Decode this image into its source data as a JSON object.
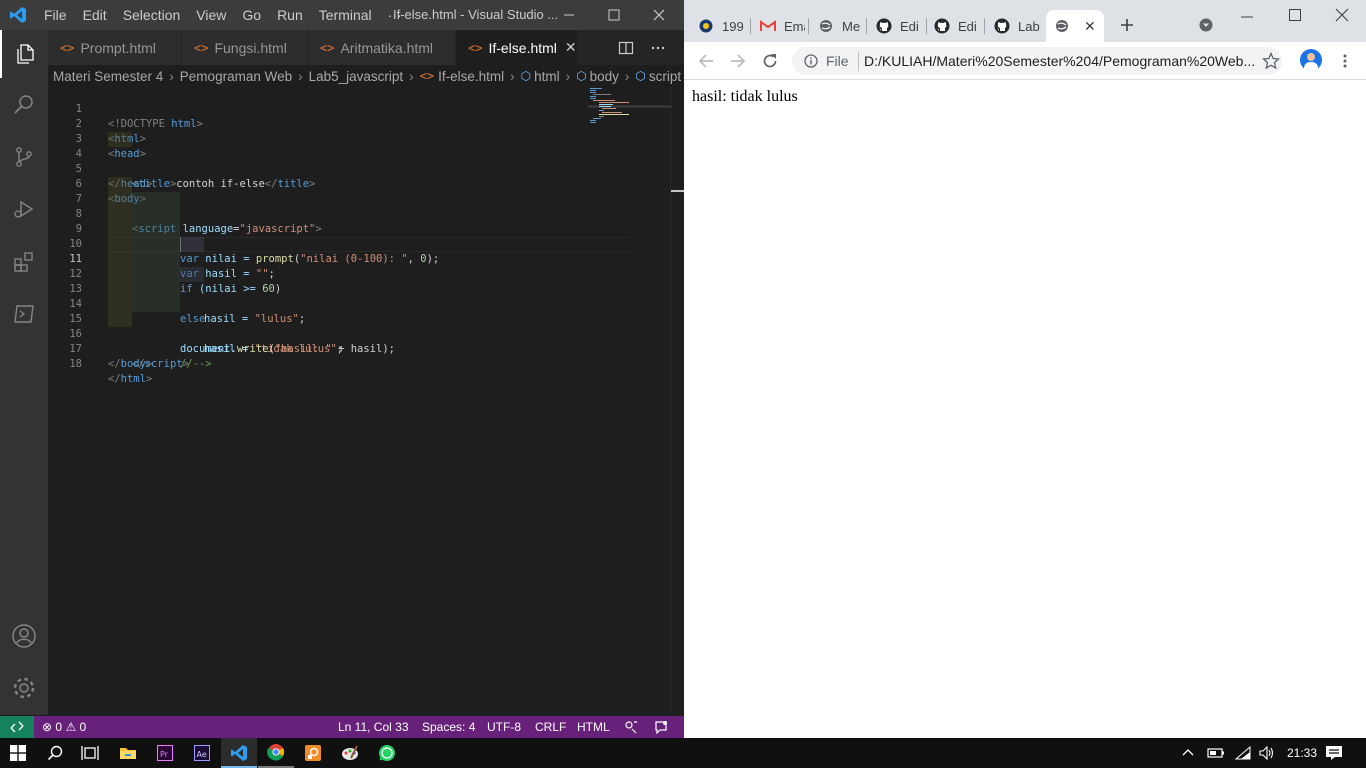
{
  "vscode": {
    "menu": [
      "File",
      "Edit",
      "Selection",
      "View",
      "Go",
      "Run",
      "Terminal"
    ],
    "menu_more": "···",
    "window_title": "If-else.html - Visual Studio ...",
    "tabs": [
      {
        "label": "Prompt.html",
        "icon": "<>"
      },
      {
        "label": "Fungsi.html",
        "icon": "<>"
      },
      {
        "label": "Aritmatika.html",
        "icon": "<>"
      },
      {
        "label": "If-else.html",
        "icon": "<>",
        "active": true
      }
    ],
    "breadcrumbs": [
      "Materi Semester 4",
      "Pemograman Web",
      "Lab5_javascript",
      "If-else.html",
      "html",
      "body",
      "script"
    ],
    "line_numbers": [
      "1",
      "2",
      "3",
      "4",
      "5",
      "6",
      "7",
      "8",
      "9",
      "10",
      "11",
      "12",
      "13",
      "14",
      "15",
      "16",
      "17",
      "18"
    ],
    "current_line": "11",
    "status": {
      "errors": "0",
      "warnings": "0",
      "position": "Ln 11, Col 33",
      "spaces": "Spaces: 4",
      "encoding": "UTF-8",
      "eol": "CRLF",
      "language": "HTML"
    }
  },
  "code": {
    "l1_doctype": "<!DOCTYPE",
    "l1_html": "html",
    "l1_close": ">",
    "l2": "html",
    "l3": "head",
    "l4_title": "title",
    "l4_text": "contoh if-else",
    "l5": "head",
    "l6": "body",
    "l7_tag": "script",
    "l7_attr": "language",
    "l7_val": "\"javascript\"",
    "l8_var": "var",
    "l8_name": "nilai =",
    "l8_fn": "prompt",
    "l8_str": "\"nilai (0-100): \"",
    "l8_num": "0",
    "l9_var": "var",
    "l9_name": "hasil =",
    "l9_str": "\"\"",
    "l10_if": "if",
    "l10_cond": "(nilai >=",
    "l10_num": "60",
    "l11_name": "hasil =",
    "l11_str": "\"lulus\"",
    "l12_else": "else",
    "l13_name": "hasil =",
    "l13_str": "\"tidak lulus\"",
    "l14_obj": "document.",
    "l14_fn": "write",
    "l14_str": "\"hasil: \"",
    "l14_rest": "+ hasil);",
    "l15_comment": "//-->",
    "l16": "script",
    "l17": "body",
    "l18": "html"
  },
  "chrome": {
    "tabs": [
      {
        "label": "199",
        "icon": "shield-favicon"
      },
      {
        "label": "Ema",
        "icon": "gmail-favicon"
      },
      {
        "label": "Me",
        "icon": "globe-favicon"
      },
      {
        "label": "Edi",
        "icon": "github-favicon"
      },
      {
        "label": "Edi",
        "icon": "github-favicon"
      },
      {
        "label": "Lab",
        "icon": "github-favicon"
      },
      {
        "label": "",
        "icon": "globe-favicon",
        "active": true
      }
    ],
    "address_scheme": "File",
    "address_url": "D:/KULIAH/Materi%20Semester%204/Pemograman%20Web...",
    "page_text": "hasil: tidak lulus"
  },
  "taskbar": {
    "time": "21:33"
  },
  "colors": {
    "vscode_status": "#68217a",
    "vscode_remote": "#16825d",
    "chrome_tabstrip": "#dee1e6",
    "taskbar": "#101010"
  }
}
